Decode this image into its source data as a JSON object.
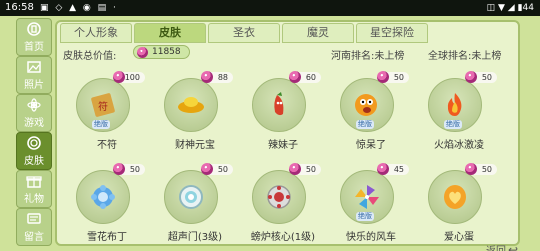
{
  "statusbar": {
    "time": "16:58",
    "icons": "▣ ◇ ▲ ◉ ▤ ·",
    "right": "◫ ▼ ◢ ▮44"
  },
  "sidebar": {
    "items": [
      {
        "label": "首页",
        "icon": "home-icon"
      },
      {
        "label": "照片",
        "icon": "photo-icon"
      },
      {
        "label": "游戏",
        "icon": "game-icon"
      },
      {
        "label": "皮肤",
        "icon": "skin-icon"
      },
      {
        "label": "礼物",
        "icon": "gift-icon"
      },
      {
        "label": "留言",
        "icon": "message-icon"
      }
    ],
    "active": 3
  },
  "tabs": [
    "个人形象",
    "皮肤",
    "圣衣",
    "魔灵",
    "星空探险"
  ],
  "active_tab": 1,
  "info": {
    "total_label": "皮肤总价值:",
    "total_value": "11858",
    "henan_rank": "河南排名:未上榜",
    "global_rank": "全球排名:未上榜"
  },
  "skins": [
    {
      "name": "不符",
      "price": "100",
      "icon": "talisman-icon",
      "color": "#d9a441",
      "badge": "绝版"
    },
    {
      "name": "财神元宝",
      "price": "88",
      "icon": "gold-ingot-icon",
      "color": "#f2c21b",
      "badge": ""
    },
    {
      "name": "辣妹子",
      "price": "60",
      "icon": "chili-pepper-icon",
      "color": "#d8402a",
      "badge": ""
    },
    {
      "name": "惊呆了",
      "price": "50",
      "icon": "shocked-face-icon",
      "color": "#f29a1e",
      "badge": "绝版"
    },
    {
      "name": "火焰冰激凌",
      "price": "50",
      "icon": "flame-icecream-icon",
      "color": "#ef5a1f",
      "badge": "绝版"
    },
    {
      "name": "雪花布丁",
      "price": "50",
      "icon": "snowflake-pudding-icon",
      "color": "#5aa7e8",
      "badge": ""
    },
    {
      "name": "超声门(3级)",
      "price": "50",
      "icon": "ultrasonic-gate-icon",
      "color": "#8fd4e0",
      "badge": ""
    },
    {
      "name": "螃炉核心(1级)",
      "price": "50",
      "icon": "reactor-core-icon",
      "color": "#c8383a",
      "badge": ""
    },
    {
      "name": "快乐的风车",
      "price": "45",
      "icon": "pinwheel-icon",
      "color": "#8a5ad0",
      "badge": "绝版"
    },
    {
      "name": "爱心蛋",
      "price": "50",
      "icon": "heart-egg-icon",
      "color": "#f4a328",
      "badge": ""
    }
  ],
  "back_label": "返回"
}
